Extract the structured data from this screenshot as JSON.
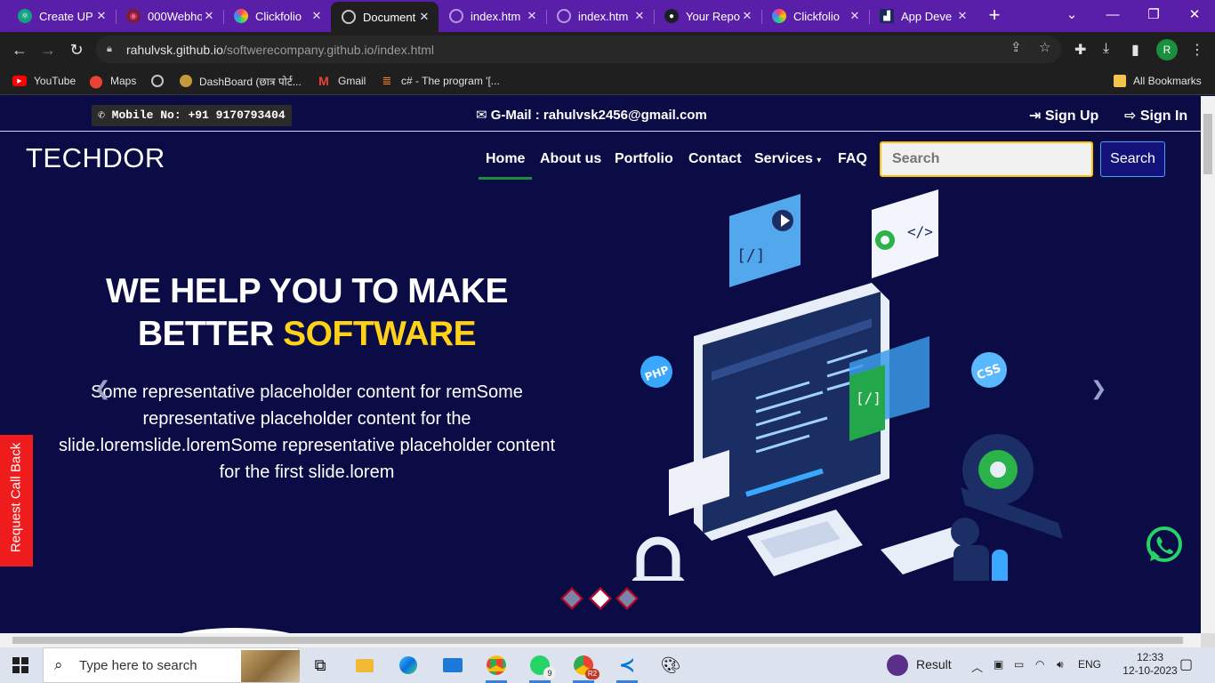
{
  "browser": {
    "tabs": [
      {
        "label": "Create UP",
        "icon": "chatgpt-icon"
      },
      {
        "label": "000Webho",
        "icon": "webhost-icon"
      },
      {
        "label": "Clickfolio",
        "icon": "clickfolio-icon"
      },
      {
        "label": "Document",
        "icon": "globe-icon",
        "active": true
      },
      {
        "label": "index.htm",
        "icon": "globe-icon"
      },
      {
        "label": "index.htm",
        "icon": "globe-icon"
      },
      {
        "label": "Your Repo",
        "icon": "github-icon"
      },
      {
        "label": "Clickfolio",
        "icon": "clickfolio-icon"
      },
      {
        "label": "App Deve",
        "icon": "app-icon"
      }
    ],
    "url_host": "rahulvsk.github.io",
    "url_path": "/softwerecompany.github.io/index.html",
    "profile_initial": "R",
    "bookmarks": [
      {
        "label": "YouTube",
        "icon": "youtube-icon"
      },
      {
        "label": "Maps",
        "icon": "maps-icon"
      },
      {
        "label": "",
        "icon": "globe-icon"
      },
      {
        "label": "DashBoard (छात्र पोर्ट...",
        "icon": "dashboard-icon"
      },
      {
        "label": "Gmail",
        "icon": "gmail-icon"
      },
      {
        "label": "c# - The program '[...",
        "icon": "stackoverflow-icon"
      }
    ],
    "all_bookmarks": "All Bookmarks"
  },
  "site": {
    "mobile": "Mobile No: +91 9170793404",
    "gmail": "G-Mail : rahulvsk2456@gmail.com",
    "signup": "Sign Up",
    "signin": "Sign In",
    "logo": "TECHDOR",
    "nav": {
      "home": "Home",
      "about": "About us",
      "portfolio": "Portfolio",
      "contact": "Contact",
      "services": "Services",
      "faq": "FAQ"
    },
    "search_placeholder": "Search",
    "search_button": "Search",
    "hero": {
      "title_line1": "WE HELP YOU TO MAKE",
      "title_line2_prefix": "BETTER ",
      "title_accent": "SOFTWARE",
      "text": "Some representative placeholder content for remSome representative placeholder content for the slide.loremslide.loremSome representative placeholder content for the first slide.lorem"
    },
    "carousel_active_index": 1,
    "callback": "Request Call Back",
    "colors": {
      "background": "#0b0b45",
      "accent": "#ffd21a",
      "nav_active": "#1a8f3c",
      "callback": "#ee1c1c"
    }
  },
  "taskbar": {
    "search_placeholder": "Type here to search",
    "whatsapp_badge": "9",
    "profile_badge": "R2",
    "result_label": "Result",
    "language": "ENG",
    "time": "12:33",
    "date": "12-10-2023"
  }
}
